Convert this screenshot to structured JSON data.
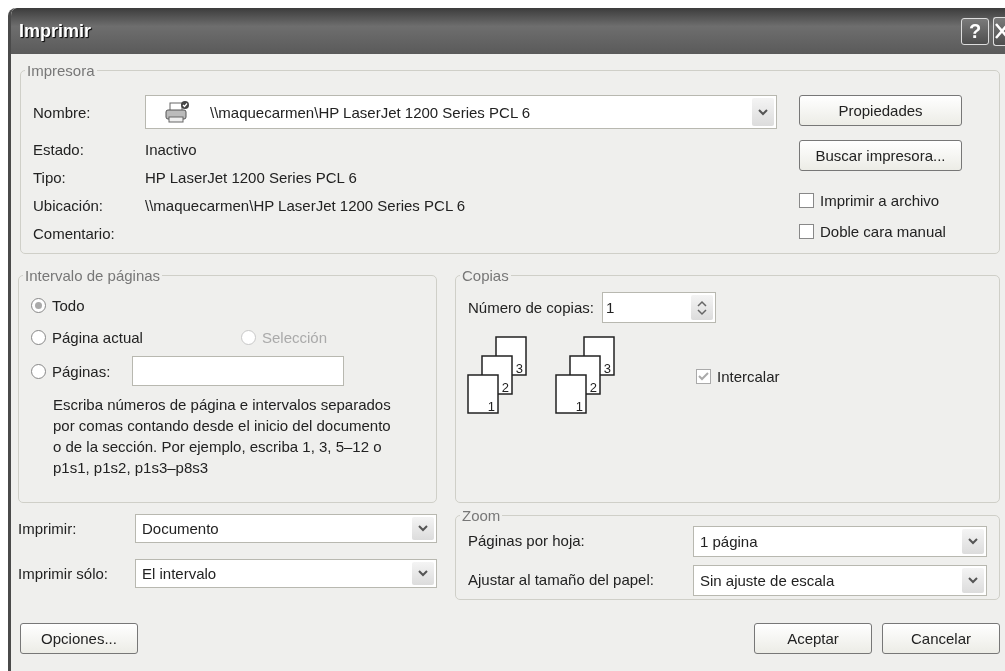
{
  "window": {
    "title": "Imprimir",
    "help_button": "?"
  },
  "printer": {
    "group_label": "Impresora",
    "name_label": "Nombre:",
    "name_value": "\\\\maquecarmen\\HP LaserJet 1200 Series PCL 6",
    "info": [
      {
        "label": "Estado:",
        "value": "Inactivo"
      },
      {
        "label": "Tipo:",
        "value": "HP LaserJet 1200 Series PCL 6"
      },
      {
        "label": "Ubicación:",
        "value": "\\\\maquecarmen\\HP LaserJet 1200 Series PCL 6"
      },
      {
        "label": "Comentario:"
      }
    ],
    "buttons": [
      "Propiedades",
      "Buscar impresora..."
    ],
    "options": [
      {
        "label": "Imprimir a archivo",
        "checked": false
      },
      {
        "label": "Doble cara manual",
        "checked": false
      }
    ]
  },
  "page_range": {
    "group_label": "Intervalo de páginas",
    "options": [
      {
        "label": "Todo",
        "selected": true,
        "disabled": false
      },
      {
        "label": "Página actual",
        "selected": false,
        "disabled": false
      },
      {
        "label": "Selección",
        "selected": false,
        "disabled": true
      },
      {
        "label": "Páginas:",
        "selected": false,
        "disabled": false
      }
    ],
    "hint": "Escriba números de página e intervalos separados por comas contando desde el inicio del documento o de la sección. Por ejemplo, escriba 1, 3, 5–12 o p1s1, p1s2, p1s3–p8s3"
  },
  "print_what": [
    {
      "label": "Imprimir:",
      "value": "Documento"
    },
    {
      "label": "Imprimir sólo:",
      "value": "El intervalo"
    }
  ],
  "copies": {
    "group_label": "Copias",
    "label": "Número de copias:",
    "value": "1",
    "stacks": [
      [
        "3",
        "2",
        "1"
      ],
      [
        "3",
        "2",
        "1"
      ]
    ],
    "collate": {
      "label": "Intercalar",
      "checked": true,
      "disabled": true
    }
  },
  "zoom": {
    "group_label": "Zoom",
    "rows": [
      {
        "label": "Páginas por hoja:",
        "value": "1 página"
      },
      {
        "label": "Ajustar al tamaño del papel:",
        "value": "Sin ajuste de escala"
      }
    ]
  },
  "footer_left": [
    "Opciones..."
  ],
  "footer_right": [
    "Aceptar",
    "Cancelar"
  ]
}
